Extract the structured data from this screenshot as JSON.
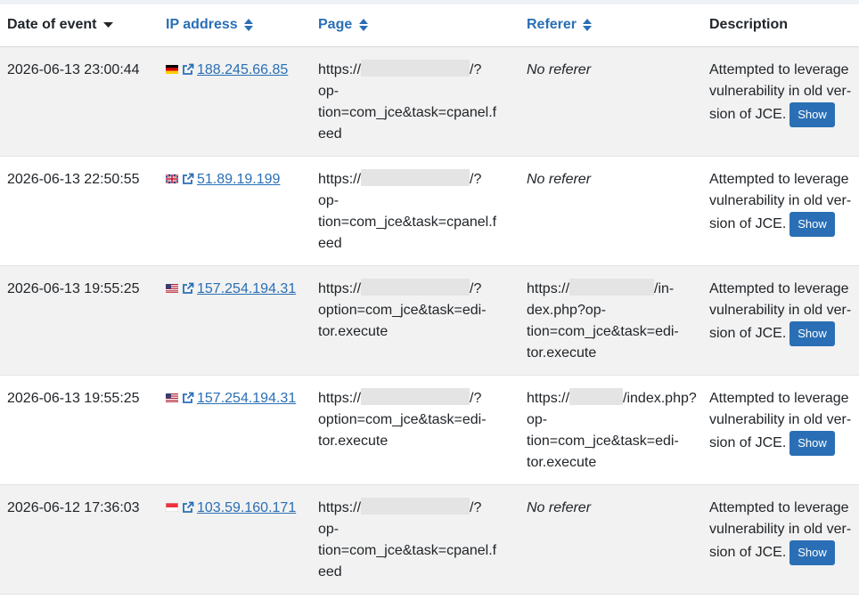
{
  "columns": {
    "date": "Date of event",
    "ip": "IP address",
    "page": "Page",
    "referer": "Referer",
    "description": "Description"
  },
  "colors": {
    "link": "#2a6fb5",
    "button": "#2a6fb5",
    "row_alt": "#f2f2f2"
  },
  "rows": [
    {
      "date": "2026-06-13 23:00:44",
      "flag": "de",
      "ip": "188.245.66.85",
      "page": [
        "https://",
        "/?",
        "op-",
        "tion=com_jce&task=cpanel.f",
        "eed"
      ],
      "referer_none": "No referer",
      "desc": [
        "Attempted to leverage",
        "vulnerability in old ver-",
        "sion of JCE."
      ],
      "button": "Show"
    },
    {
      "date": "2026-06-13 22:50:55",
      "flag": "gb",
      "ip": "51.89.19.199",
      "page": [
        "https://",
        "/?",
        "op-",
        "tion=com_jce&task=cpanel.f",
        "eed"
      ],
      "referer_none": "No referer",
      "desc": [
        "Attempted to leverage",
        "vulnerability in old ver-",
        "sion of JCE."
      ],
      "button": "Show"
    },
    {
      "date": "2026-06-13 19:55:25",
      "flag": "us",
      "ip": "157.254.194.31",
      "page": [
        "https://",
        "/?",
        "option=com_jce&task=edi-",
        "tor.execute"
      ],
      "referer": [
        "https://",
        "/in-",
        "dex.php?op-",
        "tion=com_jce&task=edi-",
        "tor.execute"
      ],
      "desc": [
        "Attempted to leverage",
        "vulnerability in old ver-",
        "sion of JCE."
      ],
      "button": "Show"
    },
    {
      "date": "2026-06-13 19:55:25",
      "flag": "us",
      "ip": "157.254.194.31",
      "page": [
        "https://",
        "/?",
        "option=com_jce&task=edi-",
        "tor.execute"
      ],
      "referer": [
        "https://",
        "/index.php?",
        "op-",
        "tion=com_jce&task=edi-",
        "tor.execute"
      ],
      "desc": [
        "Attempted to leverage",
        "vulnerability in old ver-",
        "sion of JCE."
      ],
      "button": "Show"
    },
    {
      "date": "2026-06-12 17:36:03",
      "flag": "sg",
      "ip": "103.59.160.171",
      "page": [
        "https://",
        "/?",
        "op-",
        "tion=com_jce&task=cpanel.f",
        "eed"
      ],
      "referer_none": "No referer",
      "desc": [
        "Attempted to leverage",
        "vulnerability in old ver-",
        "sion of JCE."
      ],
      "button": "Show"
    }
  ]
}
